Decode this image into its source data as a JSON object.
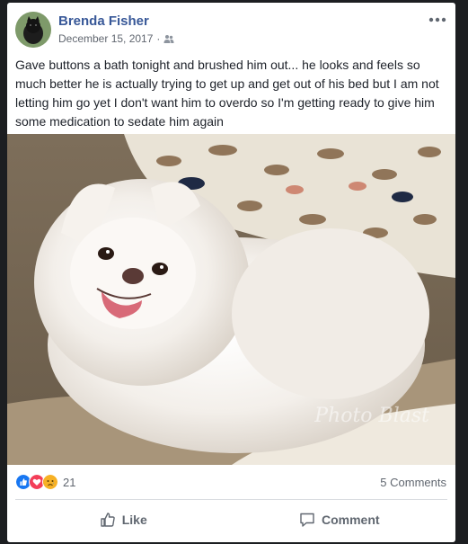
{
  "post": {
    "author": "Brenda Fisher",
    "date": "December 15, 2017",
    "audience_icon": "friends-icon",
    "text": "Gave buttons a bath tonight and brushed him out... he looks and feels so much better he is actually trying to get up and get out of his bed but I am not letting him go yet I don't want him to overdo so I'm getting ready to give him some medication to sedate him again",
    "photo_watermark": "Photo Blast"
  },
  "reactions": {
    "icons": [
      "like-icon",
      "love-icon",
      "sad-icon"
    ],
    "count": "21"
  },
  "comments_count": "5 Comments",
  "actions": {
    "like_label": "Like",
    "comment_label": "Comment"
  },
  "colors": {
    "author_link": "#385898",
    "like_blue": "#1877f2",
    "love_red": "#f33e58",
    "sad_yellow": "#f7b125"
  }
}
